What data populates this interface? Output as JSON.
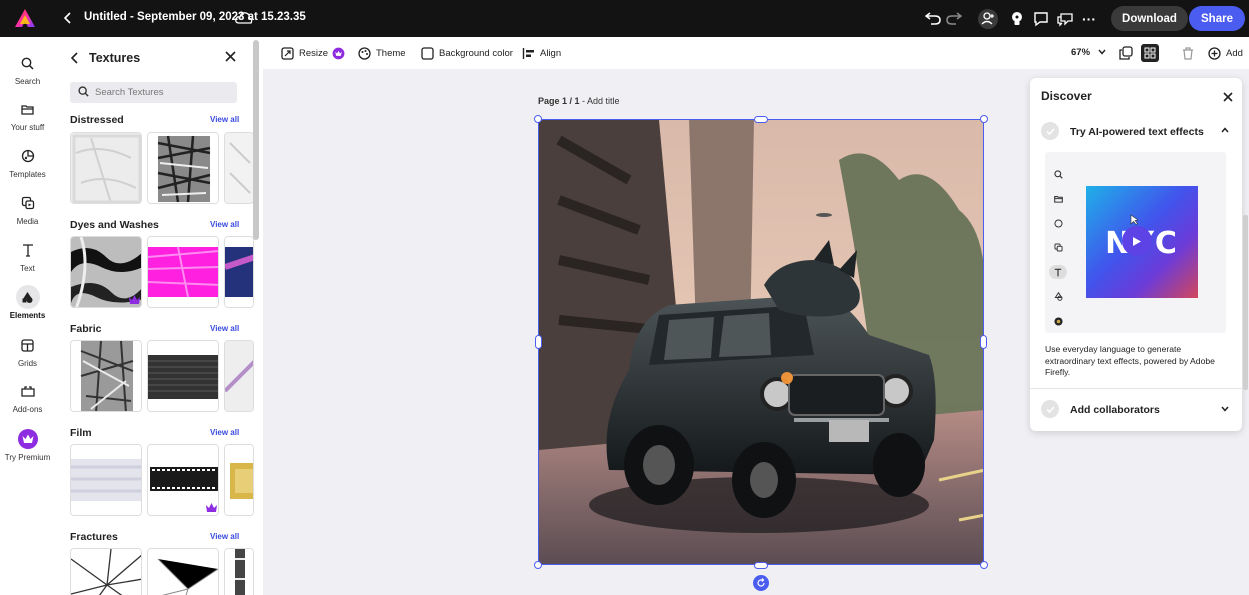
{
  "topbar": {
    "doc_title": "Untitled - September 09, 2023 at 15.23.35",
    "download_label": "Download",
    "share_label": "Share",
    "more_label": "···"
  },
  "rail": {
    "items": [
      {
        "label": "Search",
        "icon": "search-icon"
      },
      {
        "label": "Your stuff",
        "icon": "folder-icon"
      },
      {
        "label": "Templates",
        "icon": "templates-icon"
      },
      {
        "label": "Media",
        "icon": "media-icon"
      },
      {
        "label": "Text",
        "icon": "text-icon"
      },
      {
        "label": "Elements",
        "icon": "elements-icon"
      },
      {
        "label": "Grids",
        "icon": "grids-icon"
      },
      {
        "label": "Add-ons",
        "icon": "addons-icon"
      },
      {
        "label": "Try Premium",
        "icon": "premium-crown-icon"
      }
    ]
  },
  "panel": {
    "title": "Textures",
    "search_placeholder": "Search Textures",
    "sections": [
      {
        "title": "Distressed",
        "view_all": "View all"
      },
      {
        "title": "Dyes and Washes",
        "view_all": "View all"
      },
      {
        "title": "Fabric",
        "view_all": "View all"
      },
      {
        "title": "Film",
        "view_all": "View all"
      },
      {
        "title": "Fractures",
        "view_all": "View all"
      }
    ]
  },
  "toolbar": {
    "resize": "Resize",
    "theme": "Theme",
    "background_color": "Background color",
    "align": "Align",
    "zoom": "67%",
    "add": "Add"
  },
  "canvas": {
    "page_label": "Page 1 / 1",
    "add_title": " - Add title"
  },
  "discover": {
    "title": "Discover",
    "item1_title": "Try AI-powered text effects",
    "item1_desc": "Use everyday language to generate extraordinary text effects, powered by Adobe Firefly.",
    "preview_text": "NYC",
    "item2_title": "Add collaborators"
  },
  "colors": {
    "accent": "#4b5cf0",
    "topbar": "#131313",
    "premium": "#8e2ce0"
  }
}
